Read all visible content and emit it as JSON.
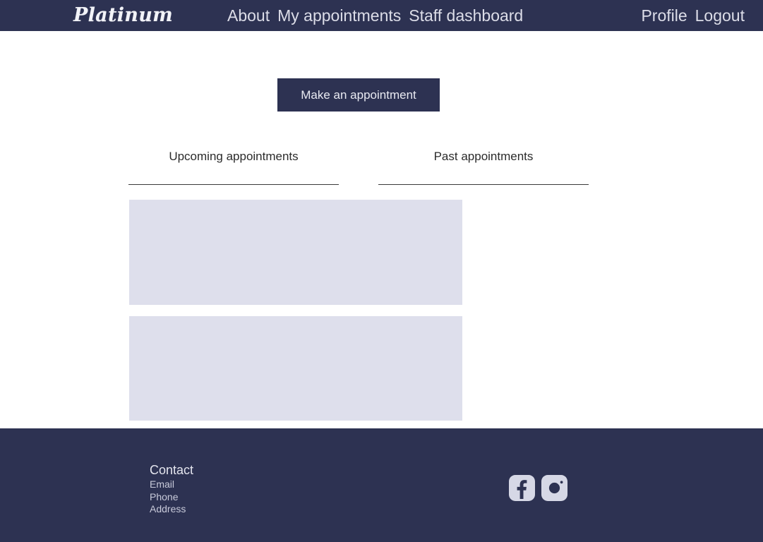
{
  "brand": {
    "name": "Platinum"
  },
  "nav": {
    "center_links": [
      {
        "label": "About",
        "name": "nav-link-about"
      },
      {
        "label": "My appointments",
        "name": "nav-link-my-appointments"
      },
      {
        "label": "Staff dashboard",
        "name": "nav-link-staff-dashboard"
      }
    ],
    "right_links": [
      {
        "label": "Profile",
        "name": "nav-link-profile"
      },
      {
        "label": "Logout",
        "name": "nav-link-logout"
      }
    ]
  },
  "main": {
    "primary_action": "Make an appointment",
    "tabs": [
      {
        "label": "Upcoming appointments"
      },
      {
        "label": "Past appointments"
      }
    ],
    "appointment_cards": [
      {
        "content": ""
      },
      {
        "content": ""
      }
    ]
  },
  "footer": {
    "contact_title": "Contact",
    "contact_items": [
      {
        "label": "Email"
      },
      {
        "label": "Phone"
      },
      {
        "label": "Address"
      }
    ],
    "social": [
      {
        "name": "facebook-icon"
      },
      {
        "name": "instagram-icon"
      }
    ]
  },
  "colors": {
    "navy": "#2d3252",
    "card_lavender": "#dedfec",
    "nav_text": "#dcdde8",
    "page_background": "#ffffff"
  }
}
